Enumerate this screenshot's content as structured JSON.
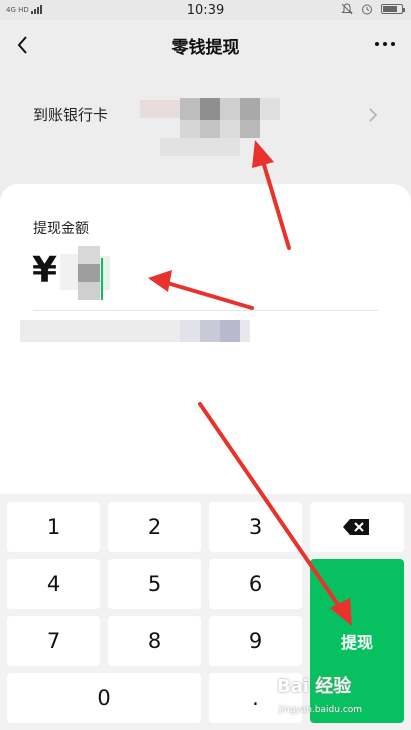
{
  "status_bar": {
    "network": "4G HD",
    "time": "10:39"
  },
  "nav": {
    "title": "零钱提现"
  },
  "bank_card": {
    "label": "到账银行卡"
  },
  "withdraw": {
    "amount_label": "提现金额",
    "currency_symbol": "¥"
  },
  "keypad": {
    "keys": [
      "1",
      "2",
      "3",
      "4",
      "5",
      "6",
      "7",
      "8",
      "9",
      "0",
      "."
    ],
    "submit_label": "提现"
  },
  "watermark": {
    "brand": "Bai 经验",
    "site": "jingyan.baidu.com"
  },
  "colors": {
    "accent": "#07c160",
    "annotation_arrow": "#e8322b"
  }
}
